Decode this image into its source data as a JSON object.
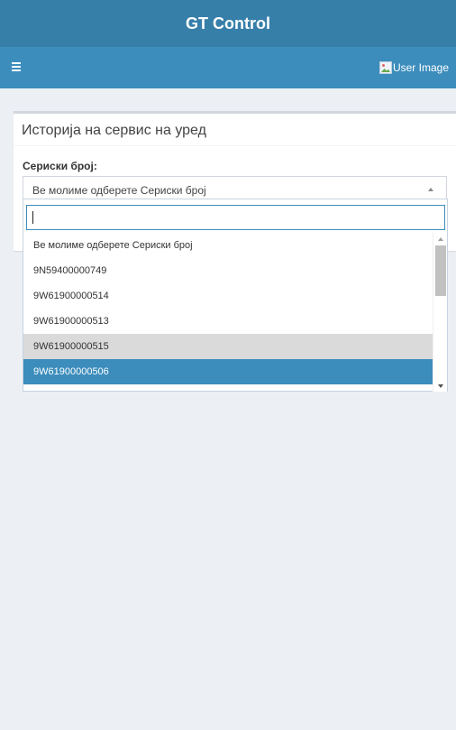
{
  "header": {
    "app_title": "GT Control",
    "user_image_alt": "User Image"
  },
  "box": {
    "title": "Историја на сервис на уред",
    "field_label": "Сериски број:",
    "select_value": "Ве молиме одберете Сериски број"
  },
  "dropdown": {
    "search_value": "",
    "options": [
      "Ве молиме одберете Сериски број",
      "9N59400000749",
      "9W61900000514",
      "9W61900000513",
      "9W61900000515",
      "9W61900000506"
    ],
    "hover_index": 4,
    "selected_index": 5
  },
  "colors": {
    "logo_bar": "#367fa9",
    "navbar": "#3c8dbc",
    "selected_option": "#3c8dbc",
    "hover_option": "#dadada",
    "page_bg": "#ecf0f5"
  },
  "icons": {
    "menu": "hamburger-menu-icon",
    "user": "broken-image-icon"
  }
}
